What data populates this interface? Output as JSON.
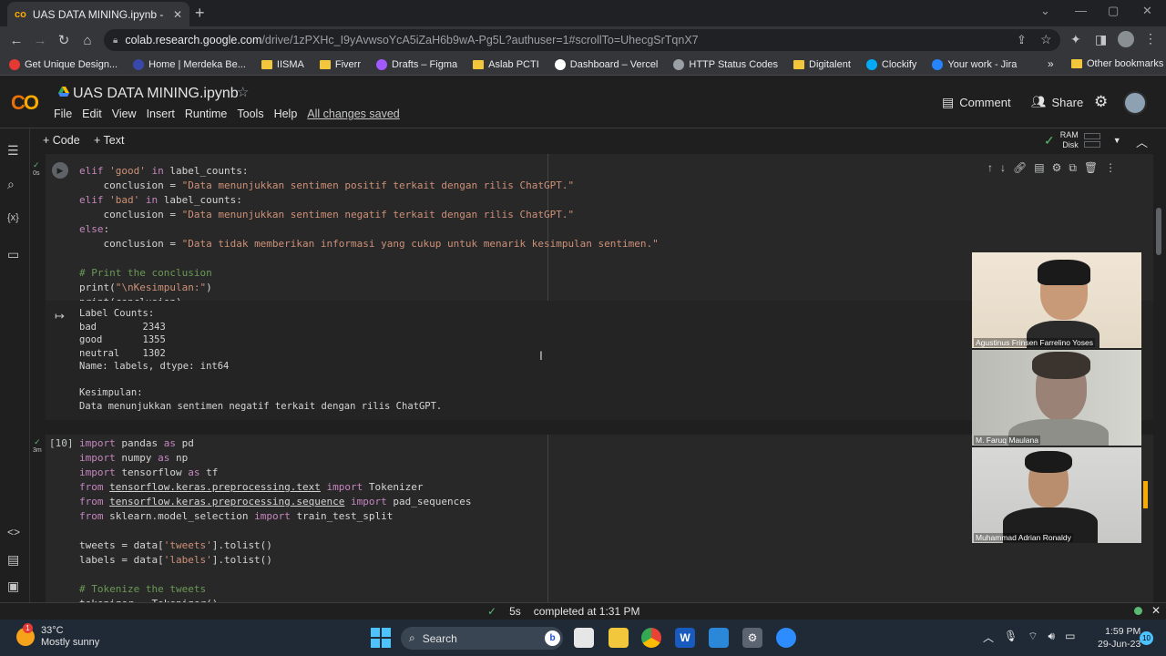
{
  "browser": {
    "tab_title": "UAS DATA MINING.ipynb - Colab",
    "url_domain": "colab.research.google.com",
    "url_path": "/drive/1zPXHc_I9yAvwsoYcA5iZaH6b9wA-Pg5L?authuser=1#scrollTo=UhecgSrTqnX7",
    "bookmarks": [
      {
        "label": "Get Unique Design...",
        "icon": "red-app-icon",
        "color": "#e53935"
      },
      {
        "label": "Home | Merdeka Be...",
        "icon": "flag-icon",
        "color": "#3949ab"
      },
      {
        "label": "IISMA",
        "icon": "folder-icon",
        "color": "#f3c73c"
      },
      {
        "label": "Fiverr",
        "icon": "folder-icon",
        "color": "#f3c73c"
      },
      {
        "label": "Drafts – Figma",
        "icon": "figma-icon",
        "color": "#a259ff"
      },
      {
        "label": "Aslab PCTI",
        "icon": "folder-icon",
        "color": "#f3c73c"
      },
      {
        "label": "Dashboard – Vercel",
        "icon": "vercel-icon",
        "color": "#ffffff"
      },
      {
        "label": "HTTP Status Codes",
        "icon": "globe-icon",
        "color": "#9aa0a6"
      },
      {
        "label": "Digitalent",
        "icon": "folder-icon",
        "color": "#f3c73c"
      },
      {
        "label": "Clockify",
        "icon": "clockify-icon",
        "color": "#03a9f4"
      },
      {
        "label": "Your work - Jira",
        "icon": "jira-icon",
        "color": "#2684ff"
      }
    ],
    "other_bookmarks": "Other bookmarks"
  },
  "colab": {
    "notebook_title": "UAS DATA MINING.ipynb",
    "menu": [
      "File",
      "Edit",
      "View",
      "Insert",
      "Runtime",
      "Tools",
      "Help"
    ],
    "saved_status": "All changes saved",
    "comment_label": "Comment",
    "share_label": "Share",
    "add_code": "+ Code",
    "add_text": "+ Text",
    "ram_label": "RAM",
    "disk_label": "Disk"
  },
  "cell1": {
    "exec_time": "0s",
    "lines": [
      "elif 'good' in label_counts:",
      "    conclusion = \"Data menunjukkan sentimen positif terkait dengan rilis ChatGPT.\"",
      "elif 'bad' in label_counts:",
      "    conclusion = \"Data menunjukkan sentimen negatif terkait dengan rilis ChatGPT.\"",
      "else:",
      "    conclusion = \"Data tidak memberikan informasi yang cukup untuk menarik kesimpulan sentimen.\"",
      "",
      "# Print the conclusion",
      "print(\"\\nKesimpulan:\")",
      "print(conclusion)"
    ],
    "output": "Label Counts:\nbad        2343\ngood       1355\nneutral    1302\nName: labels, dtype: int64\n\nKesimpulan:\nData menunjukkan sentimen negatif terkait dengan rilis ChatGPT."
  },
  "cell2": {
    "exec_count": "[10]",
    "exec_time": "3m",
    "lines": [
      "import pandas as pd",
      "import numpy as np",
      "import tensorflow as tf",
      "from tensorflow.keras.preprocessing.text import Tokenizer",
      "from tensorflow.keras.preprocessing.sequence import pad_sequences",
      "from sklearn.model_selection import train_test_split",
      "",
      "tweets = data['tweets'].tolist()",
      "labels = data['labels'].tolist()",
      "",
      "# Tokenize the tweets",
      "tokenizer = Tokenizer()"
    ]
  },
  "video": [
    {
      "name": "Agustinus Frinsen Farrelino Yoses"
    },
    {
      "name": "M. Faruq Maulana"
    },
    {
      "name": "Muhammad Adrian Ronaldy"
    }
  ],
  "status": {
    "duration": "5s",
    "completed": "completed at 1:31 PM"
  },
  "taskbar": {
    "temp": "33°C",
    "weather": "Mostly sunny",
    "badge": "1",
    "search": "Search",
    "time": "1:59 PM",
    "date": "29-Jun-23",
    "notif_count": "10"
  }
}
